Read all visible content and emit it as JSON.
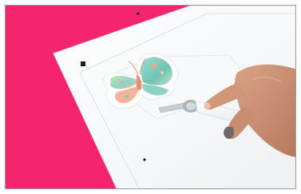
{
  "scene": {
    "subject": "hand-lifting-butterfly-sticker-from-cutting-mat",
    "colors": {
      "background": "#f5246f",
      "mat": "#fbfcfd",
      "butterfly_teal": "#7ccbbd",
      "butterfly_peach": "#f2a48a",
      "butterfly_green": "#b9dc9c",
      "skin": "#c98f72",
      "nail": "#6e6a6a",
      "tool_handle": "#e9ecef",
      "tool_grip": "#aab3ba"
    }
  }
}
